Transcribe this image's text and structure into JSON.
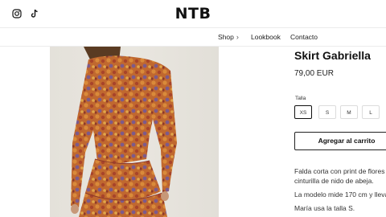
{
  "header": {
    "logo": "NTB",
    "social": [
      "instagram-icon",
      "tiktok-icon"
    ]
  },
  "nav": {
    "shop": "Shop",
    "lookbook": "Lookbook",
    "contacto": "Contacto"
  },
  "product": {
    "title": "Skirt Gabriella",
    "price": "79,00 EUR",
    "talla_label": "Talla",
    "sizes": [
      "XS",
      "S",
      "M",
      "L"
    ],
    "selected_size": "XS",
    "add_to_cart": "Agregar al carrito",
    "description": [
      "Falda corta con print de flores c",
      "cinturilla de nido de abeja.",
      "La modelo mide 170 cm y lleva",
      "María usa la talla S."
    ]
  },
  "colors": {
    "text": "#111111",
    "border": "#dcdcdc",
    "photo_bg": "#e7e4dd",
    "print_orange": "#c9742e",
    "print_red": "#b24a2a",
    "print_purple": "#7d5a8a"
  }
}
